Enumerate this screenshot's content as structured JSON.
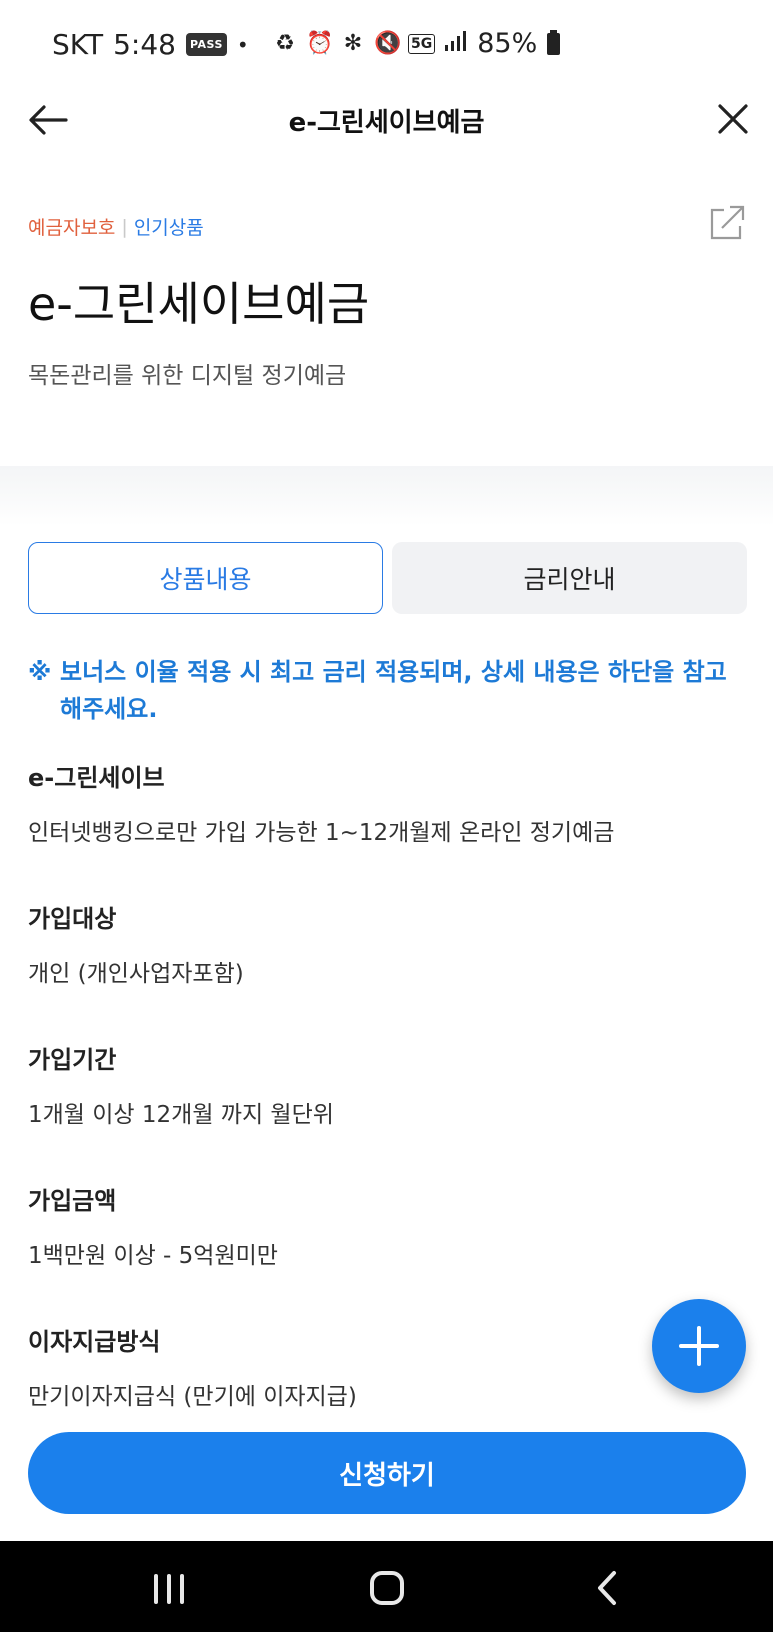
{
  "status_bar": {
    "carrier": "SKT",
    "time": "5:48",
    "pass_badge": "PASS",
    "network": "5G",
    "battery": "85%"
  },
  "header": {
    "title": "e-그린세이브예금"
  },
  "tags": {
    "protect": "예금자보호",
    "separator": "|",
    "popular": "인기상품"
  },
  "product": {
    "title": "e-그린세이브예금",
    "subtitle": "목돈관리를 위한 디지털 정기예금"
  },
  "tabs": [
    {
      "label": "상품내용",
      "active": true
    },
    {
      "label": "금리안내",
      "active": false
    }
  ],
  "notice": {
    "mark": "※",
    "text": "보너스 이율 적용 시 최고 금리 적용되며, 상세 내용은 하단을 참고 해주세요."
  },
  "sections": [
    {
      "label": "e-그린세이브",
      "value": "인터넷뱅킹으로만 가입 가능한 1~12개월제 온라인 정기예금"
    },
    {
      "label": "가입대상",
      "value": "개인 (개인사업자포함)"
    },
    {
      "label": "가입기간",
      "value": "1개월 이상 12개월 까지 월단위"
    },
    {
      "label": "가입금액",
      "value": "1백만원 이상 - 5억원미만"
    },
    {
      "label": "이자지급방식",
      "value": "만기이자지급식 (만기에 이자지급)"
    }
  ],
  "apply_button": {
    "label": "신청하기"
  },
  "colors": {
    "accent": "#1b80ec",
    "tag_protect": "#e0603d",
    "tag_popular": "#2a7be4",
    "notice": "#1d7ad6"
  }
}
